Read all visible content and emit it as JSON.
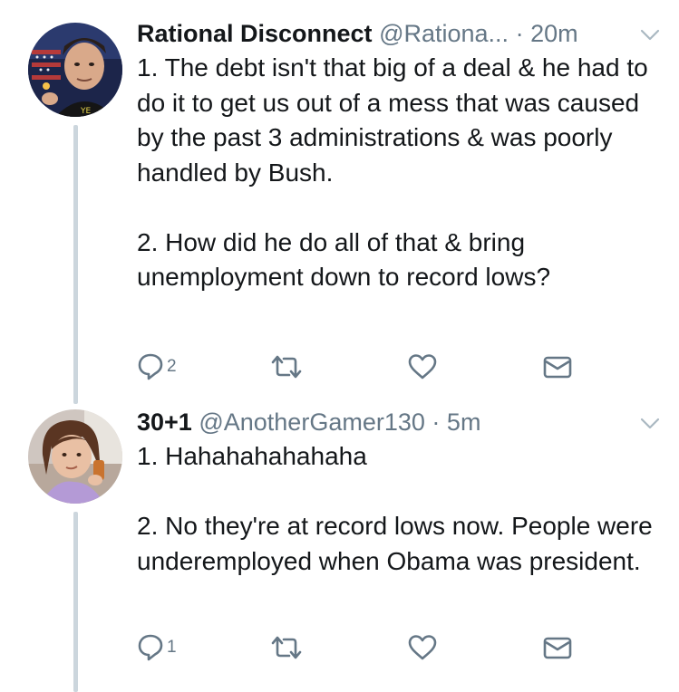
{
  "colors": {
    "text": "#14171a",
    "secondary": "#657786",
    "thread_line": "#ccd6dd"
  },
  "tweets": [
    {
      "display_name": "Rational Disconnect",
      "handle": "@Rationa...",
      "separator": "·",
      "time": "20m",
      "text": "1. The debt isn't that big of a deal & he had to do it to get us out of a mess that was caused by the past 3 administrations & was poorly handled by Bush.\n\n2. How did he do all of that & bring unemployment down to record lows?",
      "reply_count": "2",
      "icons": [
        "reply-icon",
        "retweet-icon",
        "like-icon",
        "direct-message-icon",
        "chevron-down-icon"
      ]
    },
    {
      "display_name": "30+1",
      "handle": "@AnotherGamer130",
      "separator": "·",
      "time": "5m",
      "text": "1. Hahahahahahaha\n\n2. No they're at record lows now. People were underemployed when Obama was president.",
      "reply_count": "1",
      "icons": [
        "reply-icon",
        "retweet-icon",
        "like-icon",
        "direct-message-icon",
        "chevron-down-icon"
      ]
    }
  ]
}
